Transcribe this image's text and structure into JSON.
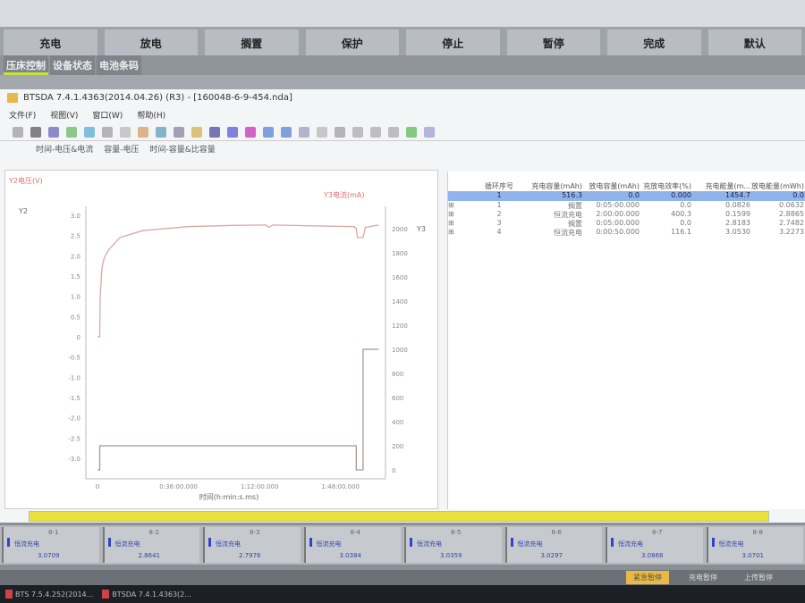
{
  "top_tabs": [
    "充电",
    "放电",
    "搁置",
    "保护",
    "停止",
    "暂停",
    "完成",
    "默认"
  ],
  "sub_tabs": [
    "压床控制",
    "设备状态",
    "电池条码"
  ],
  "window": {
    "title": "BTSDA 7.4.1.4363(2014.04.26) (R3) - [160048-6-9-454.nda]",
    "menu": [
      "文件(F)",
      "视图(V)",
      "窗口(W)",
      "帮助(H)"
    ],
    "view_tabs": [
      "时间-电压&电流",
      "容量-电压",
      "时间-容量&比容量"
    ]
  },
  "chart_data": {
    "type": "line",
    "y2label": "Y2电压(V)",
    "y3label": "Y3电流(mA)",
    "y2_short": "Y2",
    "y3_short": "Y3",
    "xlabel": "时间(h:min:s.ms)",
    "y2_ticks": [
      "3.0",
      "2.5",
      "2.0",
      "1.5",
      "1.0",
      "0.5",
      "0",
      "-0.5",
      "-1.0",
      "-1.5",
      "-2.0",
      "-2.5",
      "-3.0"
    ],
    "y3_ticks": [
      "2000",
      "1800",
      "1600",
      "1400",
      "1200",
      "1000",
      "800",
      "600",
      "400",
      "200",
      "0"
    ],
    "x_ticks": [
      "0",
      "0:36:00.000",
      "1:12:00.000",
      "1:48:00.000"
    ],
    "x_unit": "minutes",
    "xlim": [
      0,
      126
    ],
    "y2lim": [
      -3,
      3
    ],
    "y3lim": [
      0,
      2000
    ],
    "series": [
      {
        "name": "电压",
        "axis": "y2",
        "color": "#d9a9a0",
        "points": [
          [
            0,
            0
          ],
          [
            1,
            0
          ],
          [
            1.2,
            1.0
          ],
          [
            2,
            1.7
          ],
          [
            3,
            1.95
          ],
          [
            5,
            2.15
          ],
          [
            10,
            2.45
          ],
          [
            20,
            2.62
          ],
          [
            40,
            2.72
          ],
          [
            60,
            2.75
          ],
          [
            75,
            2.76
          ],
          [
            76,
            2.7
          ],
          [
            78,
            2.76
          ],
          [
            114,
            2.72
          ],
          [
            115,
            2.68
          ],
          [
            115.5,
            2.45
          ],
          [
            118,
            2.45
          ],
          [
            119,
            2.7
          ],
          [
            125,
            2.76
          ]
        ]
      },
      {
        "name": "电流",
        "axis": "y3",
        "color": "#a89890",
        "points": [
          [
            0,
            0
          ],
          [
            1,
            0
          ],
          [
            1,
            200
          ],
          [
            115,
            200
          ],
          [
            115,
            0
          ],
          [
            118,
            0
          ],
          [
            118,
            1000
          ],
          [
            125,
            1000
          ]
        ]
      }
    ]
  },
  "table": {
    "headers": [
      "循环序号",
      "充电容量(mAh)",
      "放电容量(mAh)",
      "充放电效率(%)",
      "充电能量(m...",
      "放电能量(mWh)"
    ],
    "summary": [
      "1",
      "516.3",
      "0.0",
      "0.000",
      "1454.7",
      "0.0"
    ],
    "rows": [
      [
        "1",
        "搁置",
        "0:05:00.000",
        "0.0",
        "0.0826",
        "0.0632"
      ],
      [
        "2",
        "恒流充电",
        "2:00:00.000",
        "400.3",
        "0.1599",
        "2.8865"
      ],
      [
        "3",
        "搁置",
        "0:05:00.000",
        "0.0",
        "2.8183",
        "2.7482"
      ],
      [
        "4",
        "恒流充电",
        "0:00:50.000",
        "116.1",
        "3.0530",
        "3.2273"
      ]
    ]
  },
  "channels": [
    {
      "id": "8-1",
      "st": "恒流充电",
      "v": "3.0709"
    },
    {
      "id": "8-2",
      "st": "恒流充电",
      "v": "2.8641"
    },
    {
      "id": "8-3",
      "st": "恒流充电",
      "v": "2.7976"
    },
    {
      "id": "8-4",
      "st": "恒流充电",
      "v": "3.0384"
    },
    {
      "id": "8-5",
      "st": "恒流充电",
      "v": "3.0359"
    },
    {
      "id": "8-6",
      "st": "恒流充电",
      "v": "3.0297"
    },
    {
      "id": "8-7",
      "st": "恒流充电",
      "v": "3.0868"
    },
    {
      "id": "8-8",
      "st": "恒流充电",
      "v": "3.0701"
    }
  ],
  "status_buttons": [
    "紧急暂停",
    "充电暂停",
    "上传暂停"
  ],
  "taskbar": [
    "BTS 7.5.4.252(2014...",
    "BTSDA 7.4.1.4363(2..."
  ]
}
